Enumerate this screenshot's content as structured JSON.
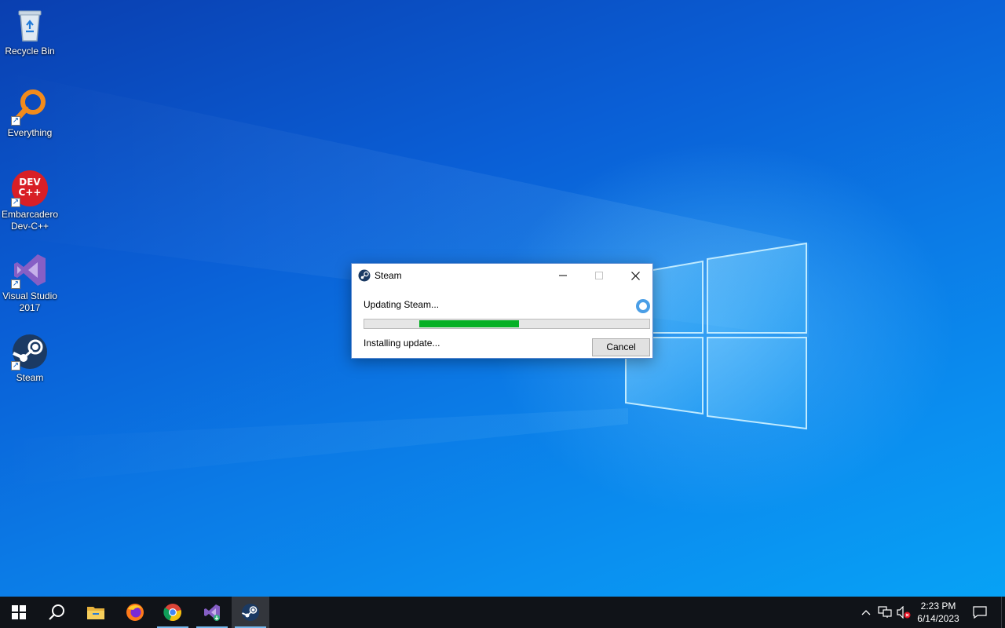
{
  "desktop": {
    "icons": [
      {
        "label": "Recycle Bin",
        "icon": "recycle-bin-icon"
      },
      {
        "label": "Everything",
        "icon": "everything-search-icon"
      },
      {
        "label_line1": "Embarcadero",
        "label_line2": "Dev-C++",
        "badge": "DEV C++",
        "icon": "devcpp-icon"
      },
      {
        "label_line1": "Visual Studio",
        "label_line2": "2017",
        "icon": "visual-studio-icon"
      },
      {
        "label": "Steam",
        "icon": "steam-icon"
      }
    ],
    "shortcut_arrow": "↗"
  },
  "dialog": {
    "title": "Steam",
    "status_top": "Updating Steam...",
    "status_bottom": "Installing update...",
    "cancel_label": "Cancel",
    "progress_fill_color": "#06b025"
  },
  "taskbar": {
    "apps": [
      "start-icon",
      "search-icon",
      "file-explorer-icon",
      "firefox-icon",
      "chrome-icon",
      "visual-studio-installer-icon",
      "steam-icon"
    ],
    "active_app": "steam-icon",
    "tray": [
      "chevron-up-icon",
      "network-icon",
      "volume-muted-icon"
    ],
    "clock_time": "2:23 PM",
    "clock_date": "6/14/2023",
    "notification": "action-center-icon"
  }
}
